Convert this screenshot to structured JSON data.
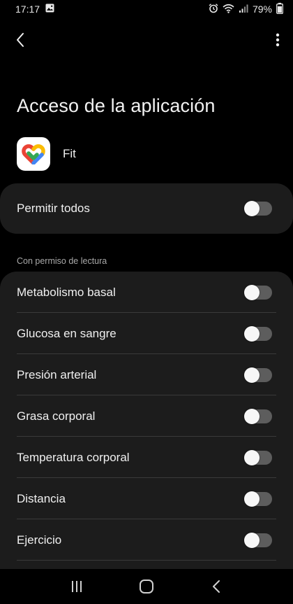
{
  "status_bar": {
    "time": "17:17",
    "battery": "79%",
    "icons": [
      "image-icon",
      "alarm-icon",
      "wifi-icon",
      "signal-icon",
      "battery-icon"
    ]
  },
  "header": {
    "title": "Acceso de la aplicación"
  },
  "app": {
    "name": "Fit",
    "icon": "google-fit-icon"
  },
  "allow_all": {
    "label": "Permitir todos",
    "enabled": false
  },
  "read_section": {
    "header": "Con permiso de lectura",
    "items": [
      {
        "label": "Metabolismo basal",
        "enabled": false
      },
      {
        "label": "Glucosa en sangre",
        "enabled": false
      },
      {
        "label": "Presión arterial",
        "enabled": false
      },
      {
        "label": "Grasa corporal",
        "enabled": false
      },
      {
        "label": "Temperatura corporal",
        "enabled": false
      },
      {
        "label": "Distancia",
        "enabled": false
      },
      {
        "label": "Ejercicio",
        "enabled": false
      }
    ]
  },
  "colors": {
    "background": "#000000",
    "card": "#1c1c1c",
    "toggle_track_off": "#5d5d5d"
  }
}
